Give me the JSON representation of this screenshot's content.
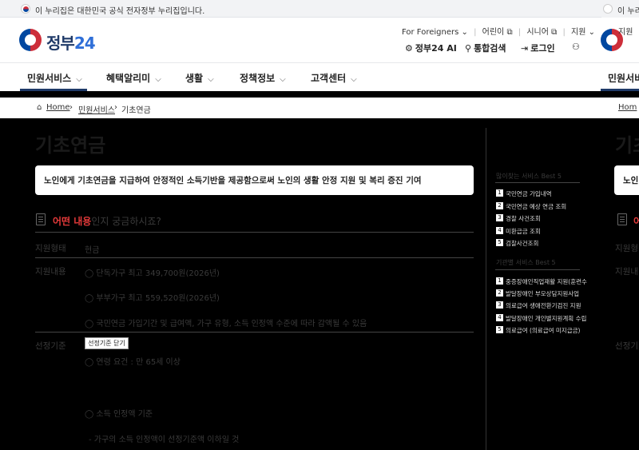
{
  "gov_notice": {
    "text": "이 누리집은 대한민국 공식 전자정부 누리집입니다."
  },
  "logo": {
    "text": "정부",
    "num": "24"
  },
  "utility": {
    "for_foreigners": "For Foreigners",
    "children": "어린이",
    "senior": "시니어",
    "support": "지원"
  },
  "actions": {
    "ai": "정부24 AI",
    "search": "통합검색",
    "login": "로그인"
  },
  "nav": [
    "민원서비스",
    "혜택알리미",
    "생활",
    "정책정보",
    "고객센터"
  ],
  "breadcrumb": {
    "home": "Home",
    "section": "민원서비스",
    "current": "기초연금"
  },
  "page_title": "기초연금",
  "summary": "노인에게 기초연금을 지급하여 안정적인 소득기반을 제공함으로써 노인의 생활 안정 지원 및 복리 증진 기여",
  "section": {
    "highlight": "어떤 내용",
    "rest": "인지 궁금하시죠?"
  },
  "rows": {
    "form_label": "지원형태",
    "form_value": "현금",
    "content_label": "지원내용",
    "content_values": [
      "◯ 단독가구 최고 349,700원(2026년)",
      "◯ 부부가구 최고 559,520원(2026년)",
      "◯ 국민연금 가입기간 및 급여액, 가구 유형, 소득 인정액 수준에 따라 감액될 수 있음"
    ],
    "criteria_label": "선정기준",
    "criteria_button": "선정기준 닫기",
    "criteria_values": [
      "◯ 연령 요건 : 만 65세 이상",
      "◯ 소득 인정액 기준",
      "- 가구의 소득 인정액이 선정기준액 이하일 것"
    ]
  },
  "sidebar": {
    "popular_title": "많이찾는 서비스 Best 5",
    "popular": [
      "국민연금 가입내역",
      "국민연금 예상 연금 조회",
      "경찰 사건조회",
      "미환급금 조회",
      "검찰사건조회"
    ],
    "recommended_title": "기관별 서비스 Best 5",
    "recommended": [
      "중증장애인직업재활 지원(훈련수",
      "발달장애인 부모상담지원사업",
      "의료급여 생애전환기검진 지원",
      "발달장애인 개인별지원계획 수립",
      "의료급여 (의료급여 미지급금)"
    ]
  },
  "clipped": {
    "support": "지원",
    "nav": "민원서비",
    "home": "Hom",
    "title": "기초",
    "summary": "노인",
    "section_hl": "어",
    "form_label": "지원형",
    "content_label": "지원내",
    "criteria_label": "선정기"
  }
}
